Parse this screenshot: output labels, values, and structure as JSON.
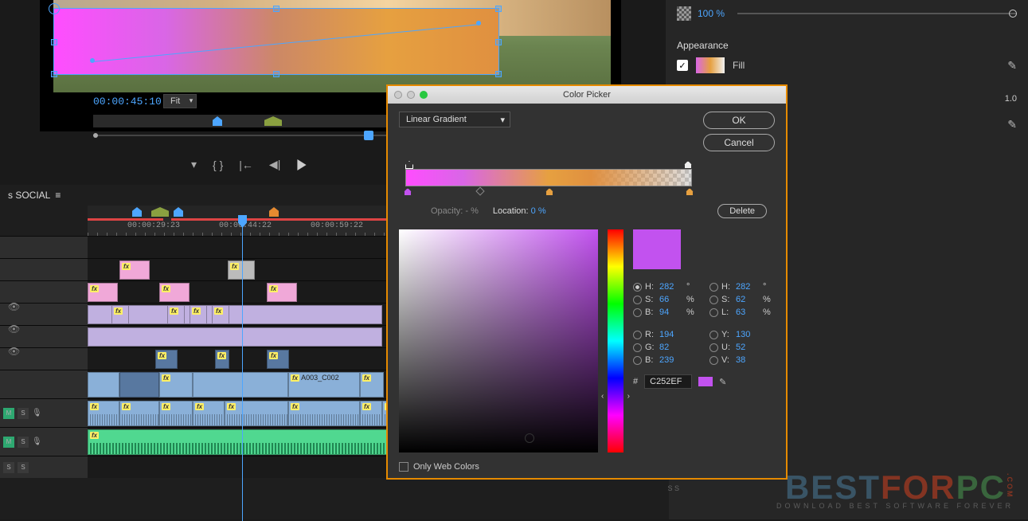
{
  "preview": {
    "timecode": "00:00:45:10",
    "zoom": "Fit"
  },
  "transport": {
    "markers_label": "markers"
  },
  "right_panel": {
    "opacity_value": "100 %",
    "appearance_title": "Appearance",
    "fill_label": "Fill",
    "fill_value": "1.0"
  },
  "timeline": {
    "sequence_name": "s SOCIAL",
    "ruler": [
      "00:00:29:23",
      "00:00:44:22",
      "00:00:59:22"
    ],
    "tracks": {
      "m_label": "M",
      "s_label": "S",
      "mic_label": "🎤"
    },
    "clip_labels": {
      "a003": "A003_C002"
    }
  },
  "color_picker": {
    "title": "Color Picker",
    "gradient_type": "Linear Gradient",
    "ok": "OK",
    "cancel": "Cancel",
    "opacity_label": "Opacity:",
    "opacity_val": "- %",
    "location_label": "Location:",
    "location_val": "0 %",
    "delete": "Delete",
    "web_colors": "Only Web Colors",
    "hex": "C252EF",
    "values": {
      "H": {
        "v": "282",
        "u": "°"
      },
      "S": {
        "v": "66",
        "u": "%"
      },
      "B": {
        "v": "94",
        "u": "%"
      },
      "H2": {
        "v": "282",
        "u": "°"
      },
      "S2": {
        "v": "62",
        "u": "%"
      },
      "L": {
        "v": "63",
        "u": "%"
      },
      "R": {
        "v": "194",
        "u": ""
      },
      "G": {
        "v": "82",
        "u": ""
      },
      "B2": {
        "v": "239",
        "u": ""
      },
      "Y": {
        "v": "130",
        "u": ""
      },
      "U": {
        "v": "52",
        "u": ""
      },
      "V": {
        "v": "38",
        "u": ""
      }
    }
  },
  "watermark": {
    "best": "BEST",
    "for": "FOR",
    "pc": "PC",
    "com": ".COM",
    "tagline": "DOWNLOAD BEST SOFTWARE FOREVER"
  }
}
